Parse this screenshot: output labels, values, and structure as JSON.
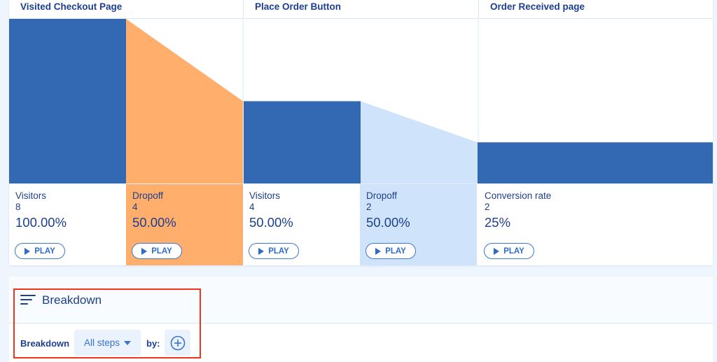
{
  "funnel": {
    "steps": [
      {
        "title": "Visited Checkout Page"
      },
      {
        "title": "Place Order Button"
      },
      {
        "title": "Order Received page"
      }
    ],
    "stats": [
      {
        "label": "Visitors",
        "count": "8",
        "percent": "100.00%",
        "play": "PLAY",
        "kind": "visitors"
      },
      {
        "label": "Dropoff",
        "count": "4",
        "percent": "50.00%",
        "play": "PLAY",
        "kind": "dropoff-orange"
      },
      {
        "label": "Visitors",
        "count": "4",
        "percent": "50.00%",
        "play": "PLAY",
        "kind": "visitors"
      },
      {
        "label": "Dropoff",
        "count": "2",
        "percent": "50.00%",
        "play": "PLAY",
        "kind": "dropoff-light"
      },
      {
        "label": "Conversion rate",
        "count": "2",
        "percent": "25%",
        "play": "PLAY",
        "kind": "conversion"
      }
    ],
    "colors": {
      "bar": "#3369b2",
      "dropoff_1": "#ffae6b",
      "dropoff_2": "#cfe4fa",
      "highlight": "#f2341c"
    }
  },
  "breakdown": {
    "title": "Breakdown",
    "label": "Breakdown",
    "select_value": "All steps",
    "by_label": "by:"
  },
  "chart_data": {
    "type": "bar",
    "title": "",
    "categories": [
      "Visited Checkout Page",
      "Place Order Button",
      "Order Received page"
    ],
    "series": [
      {
        "name": "Visitors",
        "values": [
          8,
          4,
          2
        ]
      },
      {
        "name": "Dropoff",
        "values": [
          4,
          2
        ]
      }
    ],
    "percentages": [
      "100.00%",
      "50.00%",
      "25%"
    ],
    "dropoff_percentages": [
      "50.00%",
      "50.00%"
    ],
    "ylim": [
      0,
      8
    ],
    "xlabel": "",
    "ylabel": "",
    "grid": false,
    "legend": "none"
  }
}
